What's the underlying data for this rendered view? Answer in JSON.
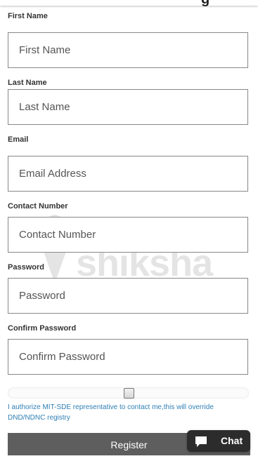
{
  "header": {
    "title_fragment": "g"
  },
  "watermark": {
    "text": "shiksha"
  },
  "form": {
    "first_name": {
      "label": "First Name",
      "placeholder": "First Name"
    },
    "last_name": {
      "label": "Last Name",
      "placeholder": "Last Name"
    },
    "email": {
      "label": "Email",
      "placeholder": "Email Address"
    },
    "contact": {
      "label": "Contact Number",
      "placeholder": "Contact Number"
    },
    "password": {
      "label": "Password",
      "placeholder": "Password"
    },
    "confirm_password": {
      "label": "Confirm Password",
      "placeholder": "Confirm Password"
    },
    "consent": {
      "text": "I authorize MIT-SDE representative to contact me,this will override DND/NDNC registry",
      "checked": false
    },
    "register_label": "Register"
  },
  "chat": {
    "label": "Chat",
    "icon": "chat-bubble-icon"
  },
  "colors": {
    "link_blue": "#2f7fb5",
    "button_gray": "#5e5e5e",
    "chat_bg": "#2c2c2c"
  }
}
